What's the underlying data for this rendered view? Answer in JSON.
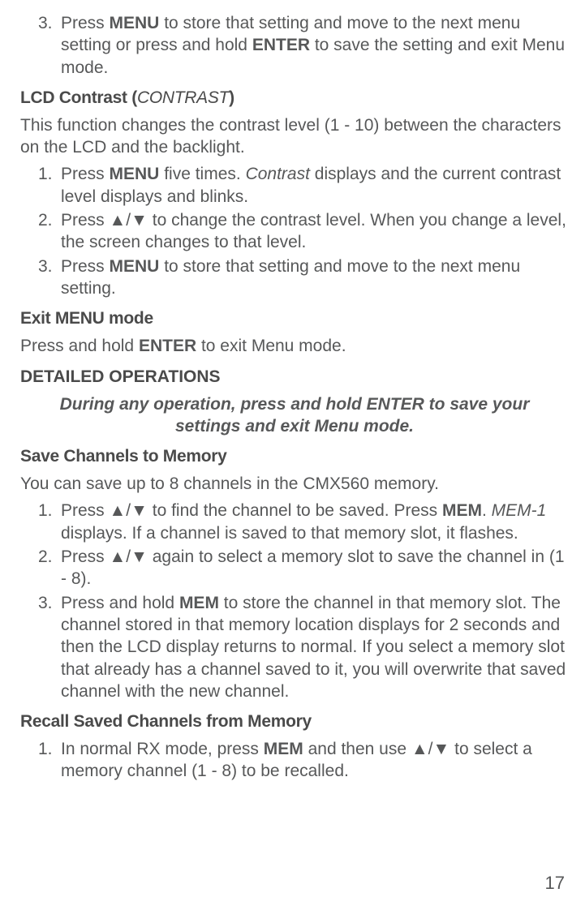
{
  "step3_top": {
    "num": "3.",
    "text_parts": [
      "Press ",
      "MENU",
      " to store that setting and move to the next menu setting or press and hold ",
      "ENTER",
      " to save the setting and exit Menu mode."
    ]
  },
  "lcd_contrast": {
    "heading_parts": [
      "LCD Contrast (",
      "CONTRAST",
      ")"
    ],
    "intro": "This function changes the contrast level (1 - 10) between the characters on the LCD and the backlight.",
    "steps": [
      {
        "num": "1.",
        "text_parts": [
          "Press ",
          "MENU",
          " five times. ",
          "Contrast",
          " displays and the current contrast level displays and blinks."
        ]
      },
      {
        "num": "2.",
        "text_parts": [
          "Press ▲/▼ to change the contrast level. When you change a level, the screen changes to that level."
        ]
      },
      {
        "num": "3.",
        "text_parts": [
          "Press ",
          "MENU",
          " to store that setting and move to the next menu setting."
        ]
      }
    ]
  },
  "exit_menu": {
    "heading": "Exit MENU mode",
    "text_parts": [
      "Press and hold ",
      "ENTER",
      " to exit Menu mode."
    ]
  },
  "detailed_ops": {
    "heading": "DETAILED OPERATIONS",
    "note": "During any operation, press and hold ENTER to save your settings and exit Menu mode."
  },
  "save_channels": {
    "heading": "Save Channels to Memory",
    "intro": "You can save up to 8 channels in the CMX560 memory.",
    "steps": [
      {
        "num": "1.",
        "text_parts": [
          "Press ▲/▼ to find the channel to be saved. Press ",
          "MEM",
          ". ",
          "MEM-1",
          " displays. If a channel is saved to that memory slot, it flashes."
        ]
      },
      {
        "num": "2.",
        "text_parts": [
          "Press ▲/▼ again to select a memory slot to save the channel in (1 - 8)."
        ]
      },
      {
        "num": "3.",
        "text_parts": [
          "Press and hold ",
          "MEM",
          " to store the channel in that memory slot. The  channel stored in that memory location displays for 2 seconds and then the LCD display returns to normal. If you select a memory slot that already has a channel saved to it, you will overwrite that saved channel with the new channel."
        ]
      }
    ]
  },
  "recall_channels": {
    "heading": "Recall Saved Channels from Memory",
    "steps": [
      {
        "num": "1.",
        "text_parts": [
          "In normal RX mode, press ",
          "MEM",
          " and then use ▲/▼ to select a memory channel (1 - 8) to be recalled."
        ]
      }
    ]
  },
  "page_number": "17"
}
